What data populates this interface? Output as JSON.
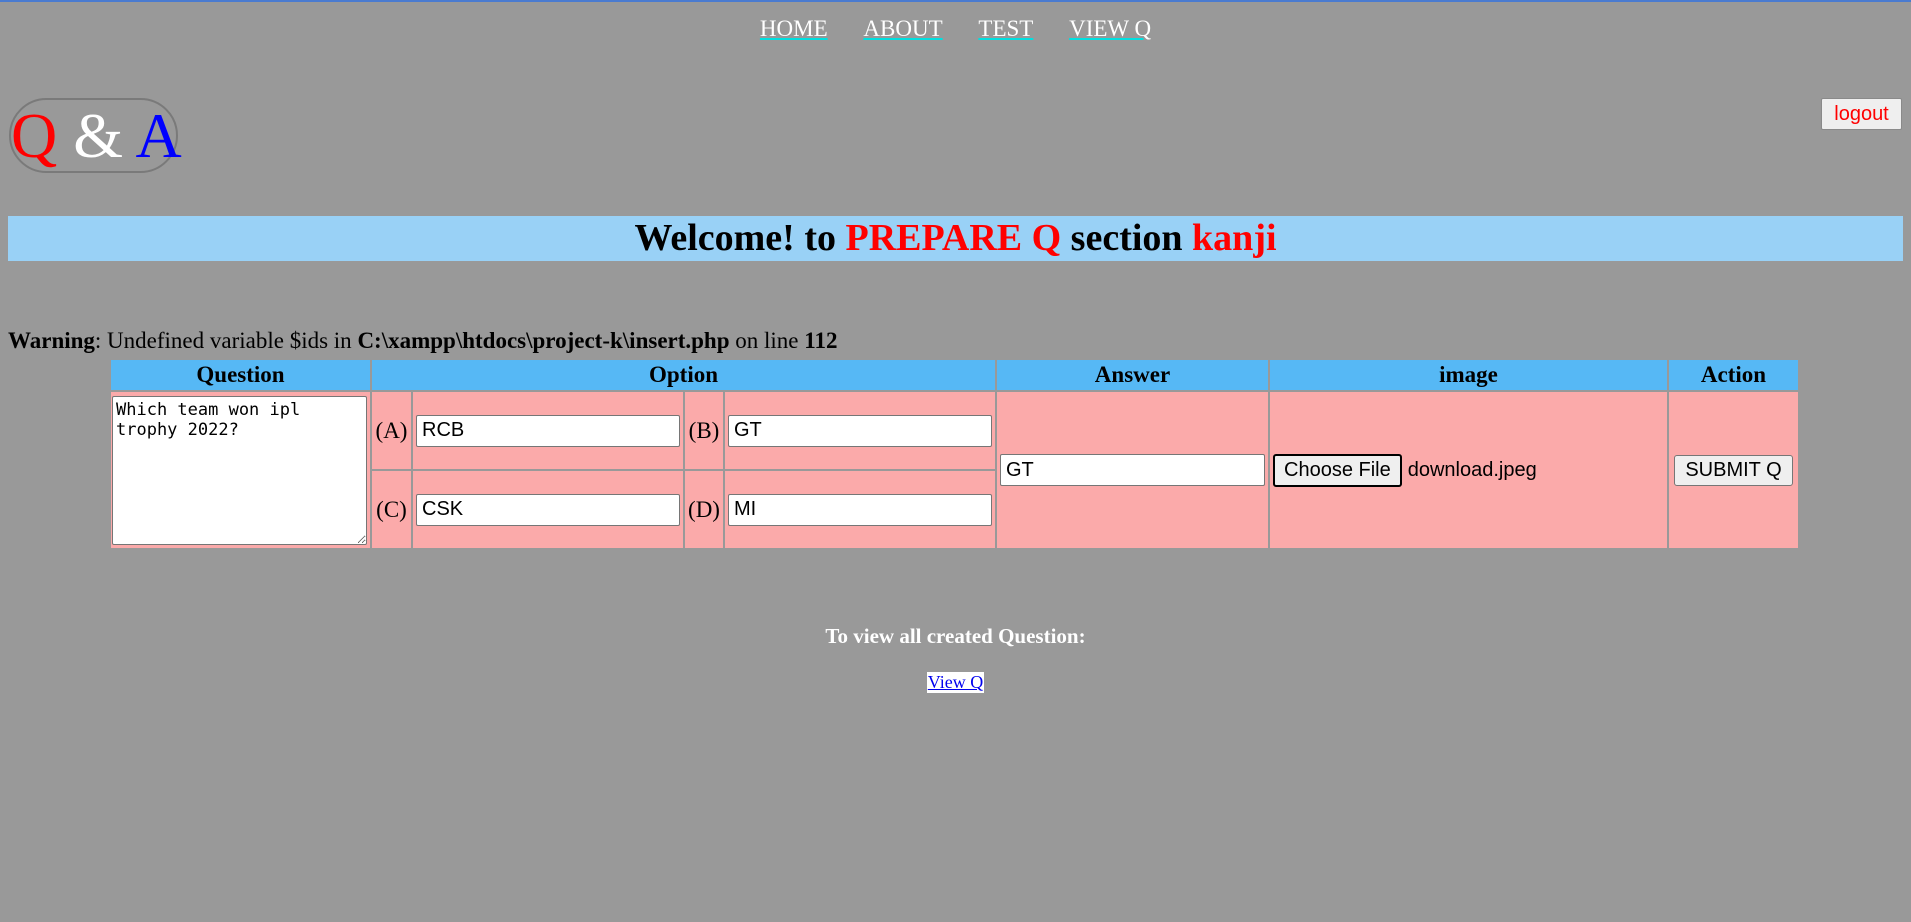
{
  "nav": {
    "home": "HOME",
    "about": "ABOUT",
    "test": "TEST",
    "view_q": "VIEW Q"
  },
  "logo": {
    "q": "Q",
    "amp": "&",
    "a": "A"
  },
  "logout_label": "logout",
  "banner": {
    "welcome": "Welcome! to",
    "section_name": "PREPARE Q",
    "section_word": "section",
    "user": "kanji"
  },
  "warning": {
    "label": "Warning",
    "message": ": Undefined variable $ids in",
    "path": "C:\\xampp\\htdocs\\project-k\\insert.php",
    "on_line": "on line",
    "line": "112"
  },
  "table": {
    "headers": {
      "question": "Question",
      "option": "Option",
      "answer": "Answer",
      "image": "image",
      "action": "Action"
    },
    "question_value": "Which team won ipl trophy 2022?",
    "options": [
      {
        "letter": "(A)",
        "value": "RCB"
      },
      {
        "letter": "(B)",
        "value": "GT"
      },
      {
        "letter": "(C)",
        "value": "CSK"
      },
      {
        "letter": "(D)",
        "value": "MI"
      }
    ],
    "answer_value": "GT",
    "choose_file_label": "Choose File",
    "file_name": "download.jpeg",
    "submit_label": "SUBMIT Q"
  },
  "view_section": {
    "text": "To view all created Question:",
    "link": "View Q"
  }
}
